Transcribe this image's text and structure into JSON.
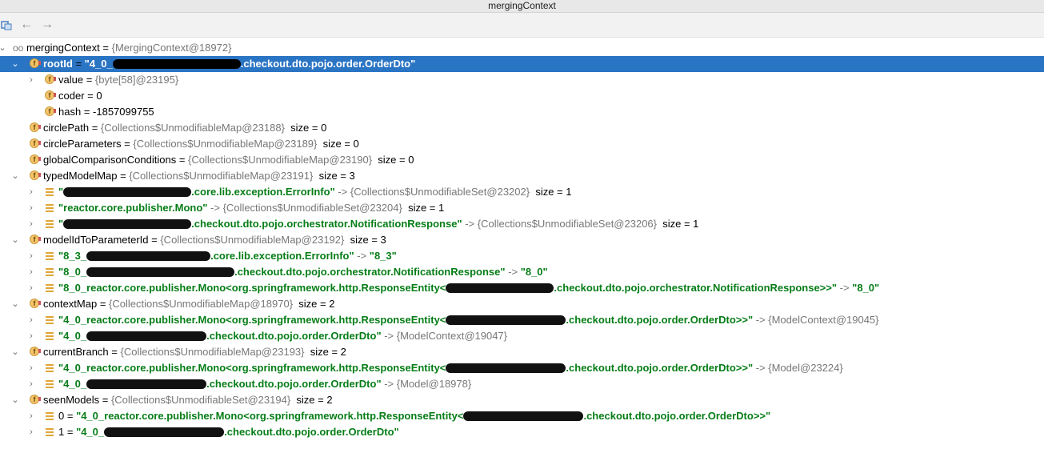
{
  "window": {
    "title": "mergingContext"
  },
  "tree": {
    "root": {
      "name": "mergingContext",
      "value": "{MergingContext@18972}"
    },
    "rows": [
      {
        "name": "rootId",
        "value": "\"4_0_",
        "value2": ".checkout.dto.pojo.order.OrderDto\""
      },
      {
        "name": "value",
        "value": "{byte[58]@23195}"
      },
      {
        "name": "coder",
        "value": "0"
      },
      {
        "name": "hash",
        "value": "-1857099755"
      },
      {
        "name": "circlePath",
        "value": "{Collections$UnmodifiableMap@23188}",
        "size": "size = 0"
      },
      {
        "name": "circleParameters",
        "value": "{Collections$UnmodifiableMap@23189}",
        "size": "size = 0"
      },
      {
        "name": "globalComparisonConditions",
        "value": "{Collections$UnmodifiableMap@23190}",
        "size": "size = 0"
      },
      {
        "name": "typedModelMap",
        "value": "{Collections$UnmodifiableMap@23191}",
        "size": "size = 3"
      },
      {
        "key1": "\"",
        "key2": ".core.lib.exception.ErrorInfo\"",
        "value": "{Collections$UnmodifiableSet@23202}",
        "size": "size = 1"
      },
      {
        "key1": "\"reactor.core.publisher.Mono\"",
        "value": "{Collections$UnmodifiableSet@23204}",
        "size": "size = 1"
      },
      {
        "key1": "\"",
        "key2": ".checkout.dto.pojo.orchestrator.NotificationResponse\"",
        "value": "{Collections$UnmodifiableSet@23206}",
        "size": "size = 1"
      },
      {
        "name": "modelIdToParameterId",
        "value": "{Collections$UnmodifiableMap@23192}",
        "size": "size = 3"
      },
      {
        "key1": "\"8_3_",
        "key2": ".core.lib.exception.ErrorInfo\"",
        "value": "\"8_3\""
      },
      {
        "key1": "\"8_0_",
        "key2": ".checkout.dto.pojo.orchestrator.NotificationResponse\"",
        "value": "\"8_0\""
      },
      {
        "key1": "\"8_0_reactor.core.publisher.Mono<org.springframework.http.ResponseEntity<",
        "key2": ".checkout.dto.pojo.orchestrator.NotificationResponse>>\"",
        "value": "\"8_0\""
      },
      {
        "name": "contextMap",
        "value": "{Collections$UnmodifiableMap@18970}",
        "size": "size = 2"
      },
      {
        "key1": "\"4_0_reactor.core.publisher.Mono<org.springframework.http.ResponseEntity<",
        "key2": ".checkout.dto.pojo.order.OrderDto>>\"",
        "value": "{ModelContext@19045}"
      },
      {
        "key1": "\"4_0_",
        "key2": ".checkout.dto.pojo.order.OrderDto\"",
        "value": "{ModelContext@19047}"
      },
      {
        "name": "currentBranch",
        "value": "{Collections$UnmodifiableMap@23193}",
        "size": "size = 2"
      },
      {
        "key1": "\"4_0_reactor.core.publisher.Mono<org.springframework.http.ResponseEntity<",
        "key2": ".checkout.dto.pojo.order.OrderDto>>\"",
        "value": "{Model@23224}"
      },
      {
        "key1": "\"4_0_",
        "key2": ".checkout.dto.pojo.order.OrderDto\"",
        "value": "{Model@18978}"
      },
      {
        "name": "seenModels",
        "value": "{Collections$UnmodifiableSet@23194}",
        "size": "size = 2"
      },
      {
        "idx": "0",
        "key1": "\"4_0_reactor.core.publisher.Mono<org.springframework.http.ResponseEntity<",
        "key2": ".checkout.dto.pojo.order.OrderDto>>\""
      },
      {
        "idx": "1",
        "key1": "\"4_0_",
        "key2": ".checkout.dto.pojo.order.OrderDto\""
      }
    ]
  },
  "icons": {
    "back": "arrow-left-icon",
    "forward": "arrow-right-icon",
    "toggle": "expand-toggle-icon"
  },
  "colors": {
    "selection": "#2a74c4",
    "string": "#067d17",
    "ref": "#777777",
    "field_icon": "#f5c46b"
  }
}
